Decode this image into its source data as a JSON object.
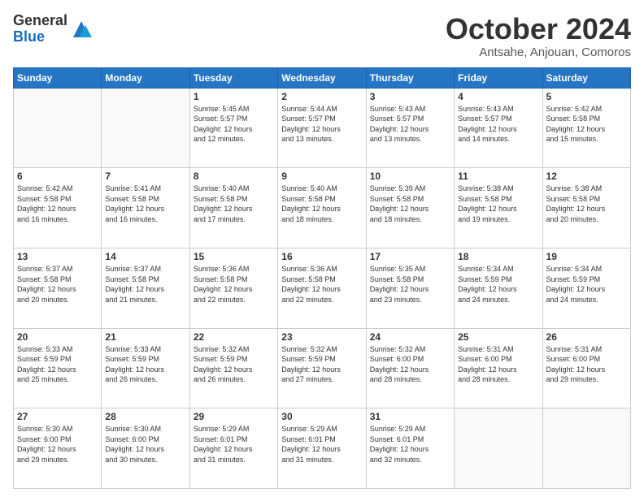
{
  "logo": {
    "general": "General",
    "blue": "Blue"
  },
  "header": {
    "month": "October 2024",
    "location": "Antsahe, Anjouan, Comoros"
  },
  "weekdays": [
    "Sunday",
    "Monday",
    "Tuesday",
    "Wednesday",
    "Thursday",
    "Friday",
    "Saturday"
  ],
  "weeks": [
    [
      {
        "day": "",
        "info": ""
      },
      {
        "day": "",
        "info": ""
      },
      {
        "day": "1",
        "info": "Sunrise: 5:45 AM\nSunset: 5:57 PM\nDaylight: 12 hours\nand 12 minutes."
      },
      {
        "day": "2",
        "info": "Sunrise: 5:44 AM\nSunset: 5:57 PM\nDaylight: 12 hours\nand 13 minutes."
      },
      {
        "day": "3",
        "info": "Sunrise: 5:43 AM\nSunset: 5:57 PM\nDaylight: 12 hours\nand 13 minutes."
      },
      {
        "day": "4",
        "info": "Sunrise: 5:43 AM\nSunset: 5:57 PM\nDaylight: 12 hours\nand 14 minutes."
      },
      {
        "day": "5",
        "info": "Sunrise: 5:42 AM\nSunset: 5:58 PM\nDaylight: 12 hours\nand 15 minutes."
      }
    ],
    [
      {
        "day": "6",
        "info": "Sunrise: 5:42 AM\nSunset: 5:58 PM\nDaylight: 12 hours\nand 16 minutes."
      },
      {
        "day": "7",
        "info": "Sunrise: 5:41 AM\nSunset: 5:58 PM\nDaylight: 12 hours\nand 16 minutes."
      },
      {
        "day": "8",
        "info": "Sunrise: 5:40 AM\nSunset: 5:58 PM\nDaylight: 12 hours\nand 17 minutes."
      },
      {
        "day": "9",
        "info": "Sunrise: 5:40 AM\nSunset: 5:58 PM\nDaylight: 12 hours\nand 18 minutes."
      },
      {
        "day": "10",
        "info": "Sunrise: 5:39 AM\nSunset: 5:58 PM\nDaylight: 12 hours\nand 18 minutes."
      },
      {
        "day": "11",
        "info": "Sunrise: 5:38 AM\nSunset: 5:58 PM\nDaylight: 12 hours\nand 19 minutes."
      },
      {
        "day": "12",
        "info": "Sunrise: 5:38 AM\nSunset: 5:58 PM\nDaylight: 12 hours\nand 20 minutes."
      }
    ],
    [
      {
        "day": "13",
        "info": "Sunrise: 5:37 AM\nSunset: 5:58 PM\nDaylight: 12 hours\nand 20 minutes."
      },
      {
        "day": "14",
        "info": "Sunrise: 5:37 AM\nSunset: 5:58 PM\nDaylight: 12 hours\nand 21 minutes."
      },
      {
        "day": "15",
        "info": "Sunrise: 5:36 AM\nSunset: 5:58 PM\nDaylight: 12 hours\nand 22 minutes."
      },
      {
        "day": "16",
        "info": "Sunrise: 5:36 AM\nSunset: 5:58 PM\nDaylight: 12 hours\nand 22 minutes."
      },
      {
        "day": "17",
        "info": "Sunrise: 5:35 AM\nSunset: 5:58 PM\nDaylight: 12 hours\nand 23 minutes."
      },
      {
        "day": "18",
        "info": "Sunrise: 5:34 AM\nSunset: 5:59 PM\nDaylight: 12 hours\nand 24 minutes."
      },
      {
        "day": "19",
        "info": "Sunrise: 5:34 AM\nSunset: 5:59 PM\nDaylight: 12 hours\nand 24 minutes."
      }
    ],
    [
      {
        "day": "20",
        "info": "Sunrise: 5:33 AM\nSunset: 5:59 PM\nDaylight: 12 hours\nand 25 minutes."
      },
      {
        "day": "21",
        "info": "Sunrise: 5:33 AM\nSunset: 5:59 PM\nDaylight: 12 hours\nand 26 minutes."
      },
      {
        "day": "22",
        "info": "Sunrise: 5:32 AM\nSunset: 5:59 PM\nDaylight: 12 hours\nand 26 minutes."
      },
      {
        "day": "23",
        "info": "Sunrise: 5:32 AM\nSunset: 5:59 PM\nDaylight: 12 hours\nand 27 minutes."
      },
      {
        "day": "24",
        "info": "Sunrise: 5:32 AM\nSunset: 6:00 PM\nDaylight: 12 hours\nand 28 minutes."
      },
      {
        "day": "25",
        "info": "Sunrise: 5:31 AM\nSunset: 6:00 PM\nDaylight: 12 hours\nand 28 minutes."
      },
      {
        "day": "26",
        "info": "Sunrise: 5:31 AM\nSunset: 6:00 PM\nDaylight: 12 hours\nand 29 minutes."
      }
    ],
    [
      {
        "day": "27",
        "info": "Sunrise: 5:30 AM\nSunset: 6:00 PM\nDaylight: 12 hours\nand 29 minutes."
      },
      {
        "day": "28",
        "info": "Sunrise: 5:30 AM\nSunset: 6:00 PM\nDaylight: 12 hours\nand 30 minutes."
      },
      {
        "day": "29",
        "info": "Sunrise: 5:29 AM\nSunset: 6:01 PM\nDaylight: 12 hours\nand 31 minutes."
      },
      {
        "day": "30",
        "info": "Sunrise: 5:29 AM\nSunset: 6:01 PM\nDaylight: 12 hours\nand 31 minutes."
      },
      {
        "day": "31",
        "info": "Sunrise: 5:29 AM\nSunset: 6:01 PM\nDaylight: 12 hours\nand 32 minutes."
      },
      {
        "day": "",
        "info": ""
      },
      {
        "day": "",
        "info": ""
      }
    ]
  ]
}
